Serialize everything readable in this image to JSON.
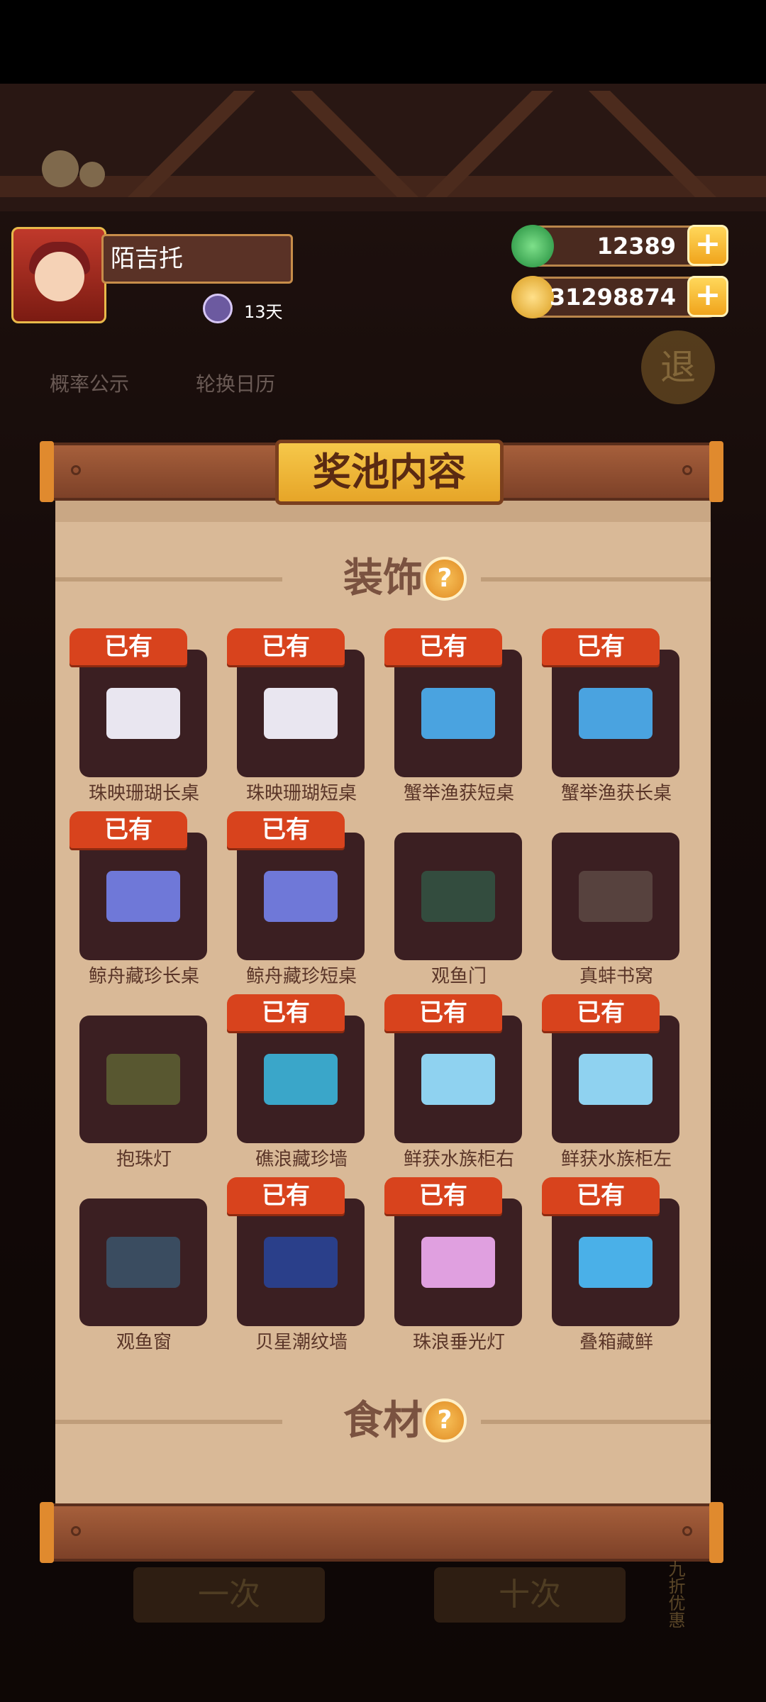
{
  "player": {
    "name": "陌吉托",
    "badge": "13天"
  },
  "currency": [
    {
      "value": "12389",
      "icon": "jade-coin-icon",
      "color": "#2fa84a",
      "plus": "+"
    },
    {
      "value": "31298874",
      "icon": "gold-coin-icon",
      "color": "#f0b429",
      "plus": "+"
    }
  ],
  "tools": {
    "probability": "概率公示",
    "rotation": "轮换日历",
    "exit": "退"
  },
  "panel": {
    "title": "奖池内容",
    "sections": [
      {
        "label": "装饰",
        "help": "?"
      },
      {
        "label": "食材",
        "help": "?"
      }
    ],
    "owned_tag": "已有",
    "items": [
      {
        "name": "珠映珊瑚长桌",
        "owned": true,
        "color": "#e9e6f0"
      },
      {
        "name": "珠映珊瑚短桌",
        "owned": true,
        "color": "#e9e6f0"
      },
      {
        "name": "蟹举渔获短桌",
        "owned": true,
        "color": "#4aa3e0"
      },
      {
        "name": "蟹举渔获长桌",
        "owned": true,
        "color": "#4aa3e0"
      },
      {
        "name": "鲸舟藏珍长桌",
        "owned": true,
        "color": "#6f78d8"
      },
      {
        "name": "鲸舟藏珍短桌",
        "owned": true,
        "color": "#6f78d8"
      },
      {
        "name": "观鱼门",
        "owned": false,
        "color": "#2e6b52"
      },
      {
        "name": "真蚌书窝",
        "owned": false,
        "color": "#6b5a52"
      },
      {
        "name": "抱珠灯",
        "owned": false,
        "color": "#6d7d3a"
      },
      {
        "name": "礁浪藏珍墙",
        "owned": true,
        "color": "#3aa6c9"
      },
      {
        "name": "鲜获水族柜右",
        "owned": true,
        "color": "#8fd2f0"
      },
      {
        "name": "鲜获水族柜左",
        "owned": true,
        "color": "#8fd2f0"
      },
      {
        "name": "观鱼窗",
        "owned": false,
        "color": "#3a6a8a"
      },
      {
        "name": "贝星潮纹墙",
        "owned": true,
        "color": "#2a3f8a"
      },
      {
        "name": "珠浪垂光灯",
        "owned": true,
        "color": "#e0a0e0"
      },
      {
        "name": "叠箱藏鲜",
        "owned": true,
        "color": "#4ab0e8"
      }
    ]
  },
  "bottom": {
    "single": "一次",
    "ten": "十次",
    "discount": "九折优惠"
  }
}
